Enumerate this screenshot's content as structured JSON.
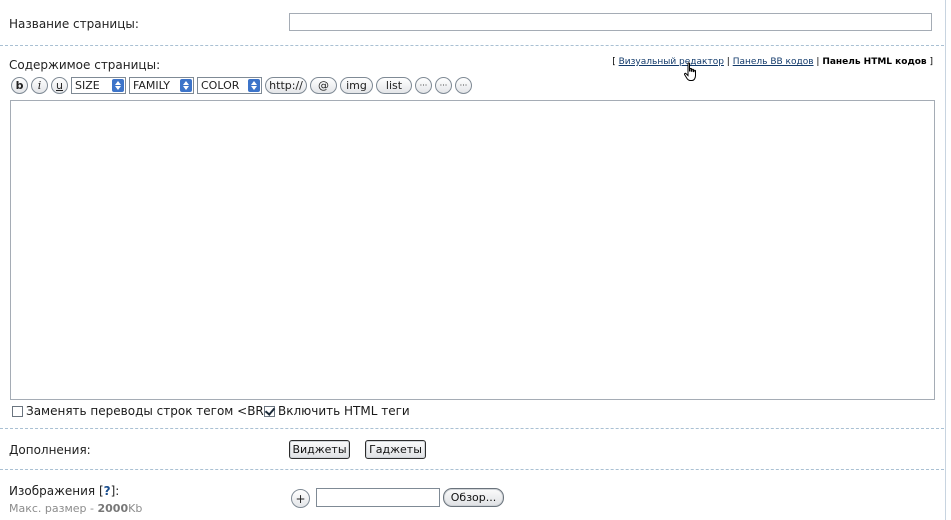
{
  "page_title": {
    "label": "Название страницы:",
    "value": ""
  },
  "content": {
    "label": "Содержимое страницы:",
    "value": "",
    "mode_links": {
      "open_bracket": "[",
      "visual_editor": "Визуальный редактор",
      "sep1": "|",
      "bb_panel": "Панель BB кодов",
      "sep2": "|",
      "html_panel": "Панель HTML кодов",
      "close_bracket": "]"
    }
  },
  "toolbar": {
    "bold": "b",
    "italic": "i",
    "underline": "u",
    "size": "SIZE",
    "family": "FAMILY",
    "color": "COLOR",
    "http": "http://",
    "at": "@",
    "img": "img",
    "list": "list",
    "more1": "···",
    "more2": "···",
    "more3": "···"
  },
  "options": {
    "replace_br": {
      "label": "Заменять переводы строк тегом <BR>",
      "checked": false
    },
    "enable_html": {
      "label": "Включить HTML теги",
      "checked": true
    }
  },
  "addons": {
    "label": "Дополнения:",
    "widgets": "Виджеты",
    "gadgets": "Гаджеты"
  },
  "images": {
    "label": "Изображения [",
    "help": "?",
    "label_end": "]:",
    "hint_prefix": "Макс. размер - ",
    "hint_size": "2000",
    "hint_unit": "Kb",
    "add": "+",
    "browse": "Обзор..."
  },
  "colors": {
    "divider": "#a9c0d3",
    "link": "#123a6b",
    "select_arrow": "#3d74c9"
  }
}
